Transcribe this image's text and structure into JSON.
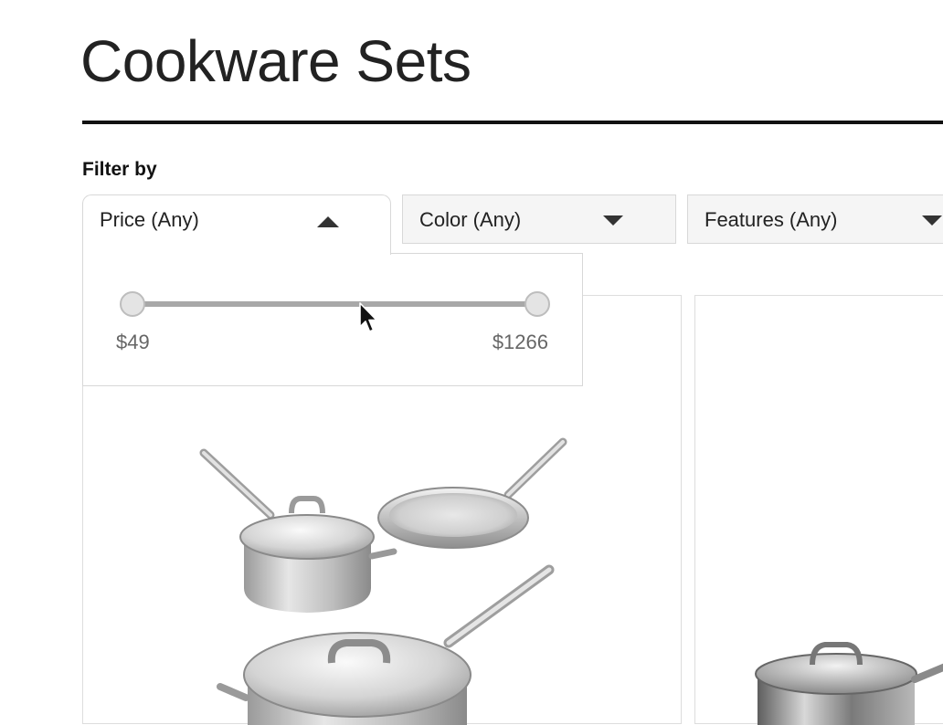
{
  "page": {
    "title": "Cookware Sets"
  },
  "filters": {
    "heading": "Filter by",
    "items": [
      {
        "label": "Price (Any)",
        "state": "expanded",
        "icon": "caret-up-icon"
      },
      {
        "label": "Color (Any)",
        "state": "collapsed",
        "icon": "caret-down-icon"
      },
      {
        "label": "Features (Any)",
        "state": "collapsed",
        "icon": "caret-down-icon"
      }
    ]
  },
  "price_panel": {
    "min_label": "$49",
    "max_label": "$1266",
    "range_low_fraction": 0,
    "range_high_fraction": 1
  },
  "products": [
    {
      "image_icon": "cookware-set-image"
    },
    {
      "image_icon": "saucepan-image"
    }
  ],
  "colors": {
    "text": "#222222",
    "muted_text": "#666666",
    "filter_bg": "#f5f5f5",
    "border": "#d8d8d8",
    "slider_track": "#a8a8a8",
    "rule": "#111111"
  }
}
